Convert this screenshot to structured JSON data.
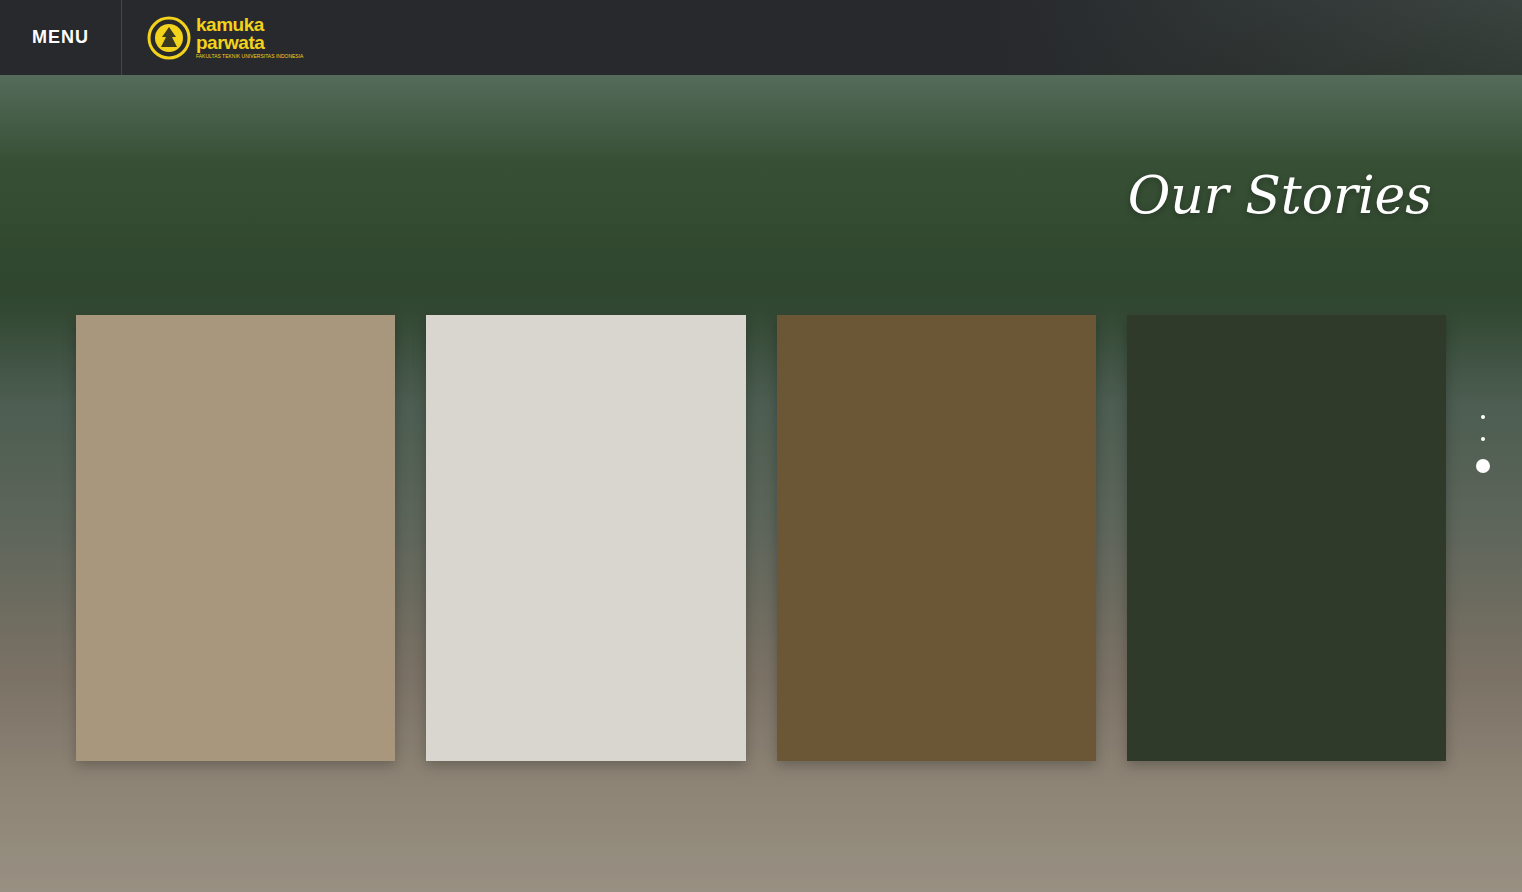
{
  "header": {
    "menu": "MENU",
    "logo": {
      "lines": [
        "kamuka",
        "parwata"
      ],
      "subtitle": "FAKULTAS TEKNIK UNIVERSITAS INDONESIA"
    }
  },
  "heading": "Our Stories",
  "stories": [
    {
      "color": "#a8977c"
    },
    {
      "color": "#d9d6cf"
    },
    {
      "color": "#6b5636"
    },
    {
      "color": "#2f3a2b"
    }
  ],
  "pages": [
    {
      "selected": false
    },
    {
      "selected": false
    },
    {
      "selected": true
    }
  ]
}
